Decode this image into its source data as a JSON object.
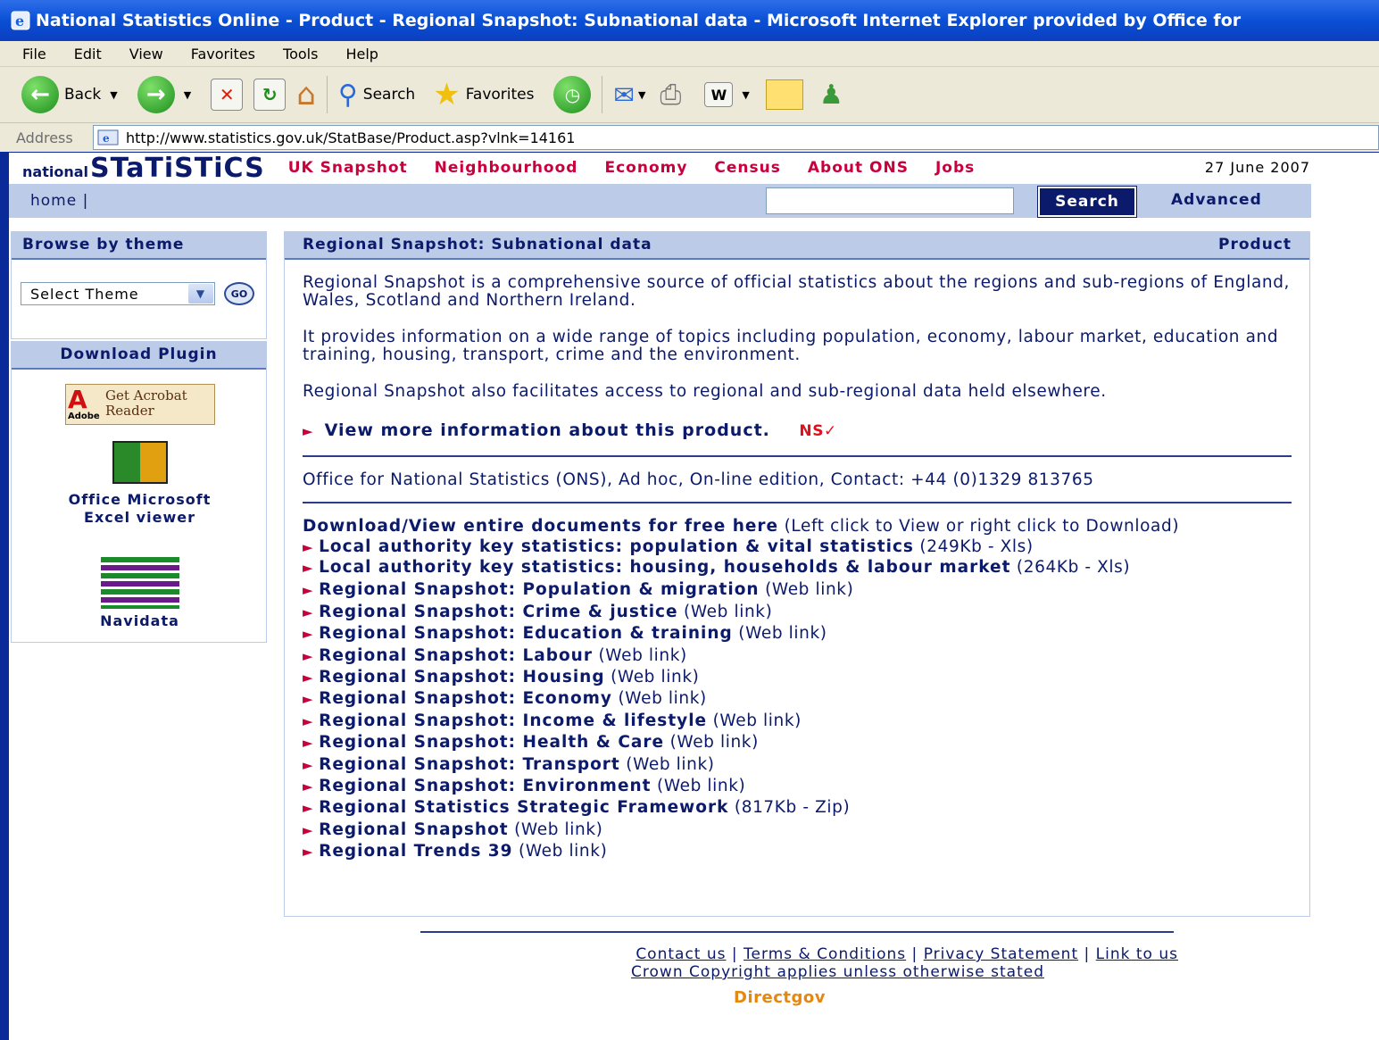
{
  "window": {
    "title": "National Statistics Online - Product - Regional Snapshot: Subnational data - Microsoft Internet Explorer provided by Office for"
  },
  "menu": [
    "File",
    "Edit",
    "View",
    "Favorites",
    "Tools",
    "Help"
  ],
  "toolbar": {
    "back_label": "Back",
    "search_label": "Search",
    "favorites_label": "Favorites"
  },
  "address": {
    "label": "Address",
    "url": "http://www.statistics.gov.uk/StatBase/Product.asp?vlnk=14161"
  },
  "site": {
    "logo_small": "national",
    "logo_big": "STaTiSTiCS",
    "nav": [
      "UK Snapshot",
      "Neighbourhood",
      "Economy",
      "Census",
      "About ONS",
      "Jobs"
    ],
    "date": "27 June 2007",
    "home_label": "home |",
    "search_button": "Search",
    "advanced_label": "Advanced"
  },
  "sidebar": {
    "browse_heading": "Browse by theme",
    "select_value": "Select Theme",
    "go_label": "GO",
    "download_heading": "Download Plugin",
    "plugins": [
      {
        "label": "",
        "logo_text": "Get Acrobat Reader",
        "logo_sub": "Adobe"
      },
      {
        "label": "Office Microsoft Excel viewer"
      },
      {
        "label": "Navidata"
      }
    ]
  },
  "main": {
    "heading": "Regional Snapshot: Subnational data",
    "heading_right": "Product",
    "paragraphs": [
      "Regional Snapshot is a comprehensive source of official statistics about the regions and sub-regions of England, Wales, Scotland and Northern Ireland.",
      "It provides information on a wide range of topics including population, economy, labour market, education and training, housing, transport, crime and the environment.",
      "Regional Snapshot also facilitates access to regional and sub-regional data held elsewhere."
    ],
    "more_info": "View more information about this product.",
    "ns_mark": "NS✓",
    "contact": "Office for National Statistics (ONS), Ad hoc, On-line edition, Contact: +44 (0)1329 813765",
    "download_bold": "Download/View entire documents for free here",
    "download_note": "(Left click to View or right click to Download)",
    "links": [
      {
        "title": "Local authority key statistics: population & vital statistics",
        "note": "(249Kb - Xls)"
      },
      {
        "title": "Local authority key statistics: housing, households & labour market",
        "note": "(264Kb - Xls)"
      },
      {
        "title": "Regional Snapshot: Population & migration",
        "note": "(Web link)"
      },
      {
        "title": "Regional Snapshot: Crime & justice",
        "note": "(Web link)"
      },
      {
        "title": "Regional Snapshot: Education & training",
        "note": "(Web link)"
      },
      {
        "title": "Regional Snapshot: Labour",
        "note": "(Web link)"
      },
      {
        "title": "Regional Snapshot: Housing",
        "note": "(Web link)"
      },
      {
        "title": "Regional Snapshot: Economy",
        "note": "(Web link)"
      },
      {
        "title": "Regional Snapshot: Income & lifestyle",
        "note": "(Web link)"
      },
      {
        "title": "Regional Snapshot: Health & Care",
        "note": "(Web link)"
      },
      {
        "title": "Regional Snapshot: Transport",
        "note": "(Web link)"
      },
      {
        "title": "Regional Snapshot: Environment",
        "note": "(Web link)"
      },
      {
        "title": "Regional Statistics Strategic Framework",
        "note": "(817Kb - Zip)"
      },
      {
        "title": "Regional Snapshot",
        "note": "(Web link)"
      },
      {
        "title": "Regional Trends 39",
        "note": "(Web link)"
      }
    ]
  },
  "footer": {
    "contact": "Contact us",
    "terms": "Terms & Conditions",
    "privacy": "Privacy Statement",
    "link": "Link to us",
    "copyright": "Crown Copyright applies unless otherwise stated",
    "directgov": "Directgov"
  },
  "colors": {
    "nav_red": "#c8003c",
    "navy": "#0b1a6a",
    "panel_blue": "#bccbe8"
  }
}
